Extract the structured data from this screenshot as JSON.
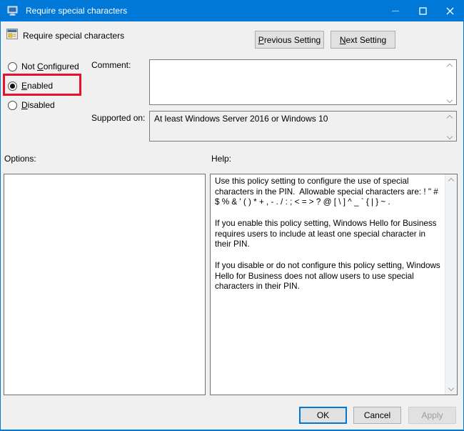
{
  "window": {
    "title": "Require special characters"
  },
  "header": {
    "policy_name": "Require special characters",
    "previous_button": {
      "key": "P",
      "post": "revious Setting"
    },
    "next_button": {
      "key": "N",
      "post": "ext Setting"
    }
  },
  "radios": [
    {
      "id": "not-configured",
      "pre": "Not ",
      "key": "C",
      "post": "onfigured",
      "selected": false,
      "highlighted": false
    },
    {
      "id": "enabled",
      "pre": "",
      "key": "E",
      "post": "nabled",
      "selected": true,
      "highlighted": true
    },
    {
      "id": "disabled",
      "pre": "",
      "key": "D",
      "post": "isabled",
      "selected": false,
      "highlighted": false
    }
  ],
  "comment": {
    "label": "Comment:",
    "value": "",
    "placeholder": ""
  },
  "supported": {
    "label": "Supported on:",
    "value": "At least Windows Server 2016 or Windows 10"
  },
  "options": {
    "label": "Options:"
  },
  "help": {
    "label": "Help:",
    "text": "Use this policy setting to configure the use of special characters in the PIN.  Allowable special characters are: ! \" # $ % & ' ( ) * + , - . / : ; < = > ? @ [ \\ ] ^ _ ` { | } ~ .\n\nIf you enable this policy setting, Windows Hello for Business requires users to include at least one special character in their PIN.\n\nIf you disable or do not configure this policy setting, Windows Hello for Business does not allow users to use special characters in their PIN."
  },
  "action_buttons": {
    "ok": "OK",
    "cancel": "Cancel",
    "apply": "Apply"
  },
  "colors": {
    "titlebar": "#0078d7",
    "highlight_red": "#e8112d",
    "default_button_border": "#0078d7",
    "window_background": "#f0f0f0"
  }
}
